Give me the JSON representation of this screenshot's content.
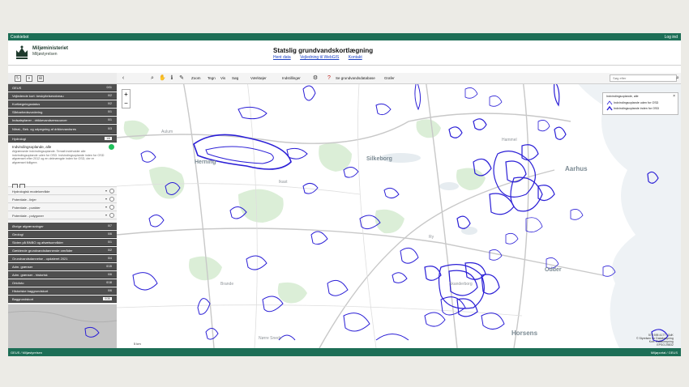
{
  "topbar": {
    "left": "Cookiebot",
    "right": "Log ind"
  },
  "header": {
    "org": "Miljøministeriet",
    "suborg": "Miljøstyrelsen",
    "title": "Statslig grundvandskortlægning",
    "links": [
      "Hent data",
      "Vejledning til WebGIS",
      "Kontakt"
    ]
  },
  "left_panel": {
    "group_rows_top": [
      {
        "label": "GEUS",
        "badge": "0/11"
      },
      {
        "label": "Vejledende kort: beskyttelsesniveau",
        "badge": "0/2"
      },
      {
        "label": "Kortlægningsstatus",
        "badge": "0/2"
      },
      {
        "label": "Sårbarhedsvurdering",
        "badge": "0/1"
      },
      {
        "label": "Indsatsplaner - drikkevandsressourcer",
        "badge": "0/1"
      },
      {
        "label": "Nitrat-, Bek. og udpegning af drikkevandsres",
        "badge": "0/3"
      },
      {
        "label": "Hydrologi",
        "badge": "1/6"
      }
    ],
    "expanded": {
      "title": "Indvindingsoplande, alle",
      "description": "Afgrænsede indvindingsoplande. Temalt indeholder alle indvindingsoplande uden for OSD. Indvindingsoplande inden for OSD afgrænset efter 2012 og en delmængde inden for OSD, der er afgrænset tidligere."
    },
    "layer_rows": [
      {
        "label": "Hydrologisk modelområde"
      },
      {
        "label": "Potentiale - linjer"
      },
      {
        "label": "Potentiale - punkter"
      },
      {
        "label": "Potentiale - polygoner"
      }
    ],
    "group_rows_bottom": [
      {
        "label": "Øvrige afgrænsninger",
        "badge": "0/7"
      },
      {
        "label": "Geologi",
        "badge": "0/6"
      },
      {
        "label": "Sloten på BNBO og afsætsområder",
        "badge": "0/1"
      },
      {
        "label": "Gældende grundvandsdannende områder",
        "badge": "0/2"
      },
      {
        "label": "Grundvandsdannelse - opdateret 2021",
        "badge": "0/4"
      },
      {
        "label": "Adm. grænser",
        "badge": "0/15"
      },
      {
        "label": "Adm. grænser - historisk",
        "badge": "0/6"
      },
      {
        "label": "Ortofoto",
        "badge": "0/18"
      },
      {
        "label": "Historiske baggrundskort",
        "badge": "0/6"
      },
      {
        "label": "Baggrundskort",
        "badge": "0/35"
      }
    ]
  },
  "map_toolbar": {
    "items": [
      "Zoom",
      "Tegn",
      "Vis",
      "Søg",
      "Værktøjer",
      "Indstillinger",
      "Se grundvandsdatabase",
      "Grafer"
    ],
    "search_placeholder": "Søg efter"
  },
  "map": {
    "cities": [
      "Silkeborg",
      "Aarhus",
      "Horsens",
      "Odder",
      "Herning"
    ],
    "towns": [
      "Aulum",
      "Ikast",
      "Brande",
      "Skanderborg",
      "Ry",
      "Hammel",
      "Nørre Snede"
    ],
    "legend": {
      "title": "Indvindingsoplande, alle",
      "items": [
        "Indvindingsoplande uden for OSD",
        "Indvindingsoplande inden for OSD"
      ]
    },
    "scale": "5 km",
    "attribution": [
      "575 595 4177 / SdK",
      "© Styrelsen for Dataforsyning",
      "Kort: Dataforsyning",
      "EPSG:25832"
    ],
    "line_color": "#2b1fd6"
  },
  "footer": {
    "left": "GEUS / Miljøstyrelsen",
    "right": "Miljøportal / GEUS"
  }
}
